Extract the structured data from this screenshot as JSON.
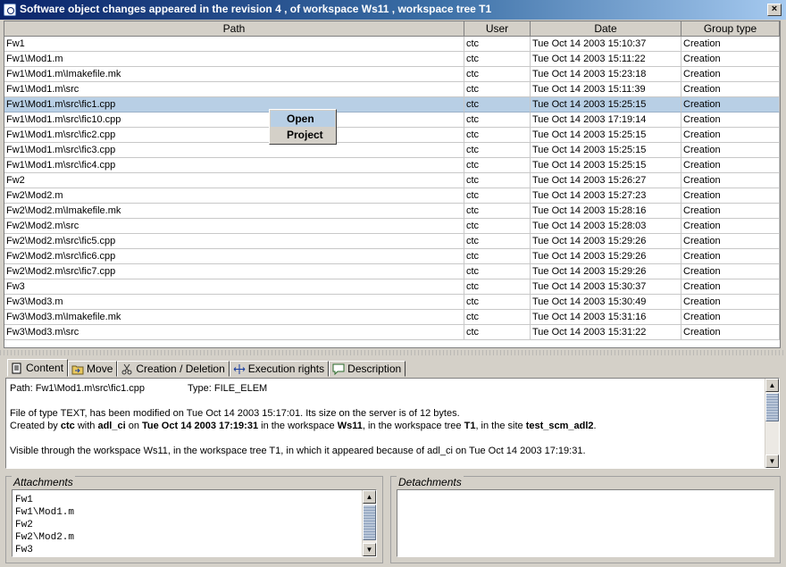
{
  "window": {
    "title": "Software object changes appeared in the revision 4 , of workspace Ws11 , workspace tree T1",
    "close_symbol": "×"
  },
  "table": {
    "columns": [
      "Path",
      "User",
      "Date",
      "Group type"
    ],
    "selected_index": 4,
    "rows": [
      [
        "Fw1",
        "ctc",
        "Tue Oct 14 2003 15:10:37",
        "Creation"
      ],
      [
        "Fw1\\Mod1.m",
        "ctc",
        "Tue Oct 14 2003 15:11:22",
        "Creation"
      ],
      [
        "Fw1\\Mod1.m\\Imakefile.mk",
        "ctc",
        "Tue Oct 14 2003 15:23:18",
        "Creation"
      ],
      [
        "Fw1\\Mod1.m\\src",
        "ctc",
        "Tue Oct 14 2003 15:11:39",
        "Creation"
      ],
      [
        "Fw1\\Mod1.m\\src\\fic1.cpp",
        "ctc",
        "Tue Oct 14 2003 15:25:15",
        "Creation"
      ],
      [
        "Fw1\\Mod1.m\\src\\fic10.cpp",
        "ctc",
        "Tue Oct 14 2003 17:19:14",
        "Creation"
      ],
      [
        "Fw1\\Mod1.m\\src\\fic2.cpp",
        "ctc",
        "Tue Oct 14 2003 15:25:15",
        "Creation"
      ],
      [
        "Fw1\\Mod1.m\\src\\fic3.cpp",
        "ctc",
        "Tue Oct 14 2003 15:25:15",
        "Creation"
      ],
      [
        "Fw1\\Mod1.m\\src\\fic4.cpp",
        "ctc",
        "Tue Oct 14 2003 15:25:15",
        "Creation"
      ],
      [
        "Fw2",
        "ctc",
        "Tue Oct 14 2003 15:26:27",
        "Creation"
      ],
      [
        "Fw2\\Mod2.m",
        "ctc",
        "Tue Oct 14 2003 15:27:23",
        "Creation"
      ],
      [
        "Fw2\\Mod2.m\\Imakefile.mk",
        "ctc",
        "Tue Oct 14 2003 15:28:16",
        "Creation"
      ],
      [
        "Fw2\\Mod2.m\\src",
        "ctc",
        "Tue Oct 14 2003 15:28:03",
        "Creation"
      ],
      [
        "Fw2\\Mod2.m\\src\\fic5.cpp",
        "ctc",
        "Tue Oct 14 2003 15:29:26",
        "Creation"
      ],
      [
        "Fw2\\Mod2.m\\src\\fic6.cpp",
        "ctc",
        "Tue Oct 14 2003 15:29:26",
        "Creation"
      ],
      [
        "Fw2\\Mod2.m\\src\\fic7.cpp",
        "ctc",
        "Tue Oct 14 2003 15:29:26",
        "Creation"
      ],
      [
        "Fw3",
        "ctc",
        "Tue Oct 14 2003 15:30:37",
        "Creation"
      ],
      [
        "Fw3\\Mod3.m",
        "ctc",
        "Tue Oct 14 2003 15:30:49",
        "Creation"
      ],
      [
        "Fw3\\Mod3.m\\Imakefile.mk",
        "ctc",
        "Tue Oct 14 2003 15:31:16",
        "Creation"
      ],
      [
        "Fw3\\Mod3.m\\src",
        "ctc",
        "Tue Oct 14 2003 15:31:22",
        "Creation"
      ]
    ]
  },
  "context_menu": {
    "items": [
      "Open",
      "Project"
    ],
    "highlighted_index": 0
  },
  "tabs": [
    {
      "label": "Content",
      "icon": "document-icon",
      "active": true
    },
    {
      "label": "Move",
      "icon": "folder-move-icon",
      "active": false
    },
    {
      "label": "Creation / Deletion",
      "icon": "scissors-icon",
      "active": false
    },
    {
      "label": "Execution rights",
      "icon": "arrows-icon",
      "active": false
    },
    {
      "label": "Description",
      "icon": "speech-bubble-icon",
      "active": false
    }
  ],
  "details": {
    "path_label": "Path:",
    "path_value": "Fw1\\Mod1.m\\src\\fic1.cpp",
    "type_label": "Type:",
    "type_value": "FILE_ELEM",
    "line1": "File of type TEXT, has been modified on Tue Oct 14 2003 15:17:01. Its size on the server is of 12 bytes.",
    "line2_parts": [
      {
        "text": "Created by ",
        "bold": false
      },
      {
        "text": "ctc",
        "bold": true
      },
      {
        "text": " with ",
        "bold": false
      },
      {
        "text": "adl_ci",
        "bold": true
      },
      {
        "text": " on ",
        "bold": false
      },
      {
        "text": "Tue Oct 14 2003 17:19:31",
        "bold": true
      },
      {
        "text": " in the workspace ",
        "bold": false
      },
      {
        "text": "Ws11",
        "bold": true
      },
      {
        "text": ", in the workspace tree ",
        "bold": false
      },
      {
        "text": "T1",
        "bold": true
      },
      {
        "text": ", in the site ",
        "bold": false
      },
      {
        "text": "test_scm_adl2",
        "bold": true
      },
      {
        "text": ".",
        "bold": false
      }
    ],
    "line3": "Visible through the workspace Ws11, in the workspace tree T1, in which it appeared because of adl_ci on Tue Oct 14 2003 17:19:31."
  },
  "attachments": {
    "title": "Attachments",
    "items": [
      "Fw1",
      "Fw1\\Mod1.m",
      "Fw2",
      "Fw2\\Mod2.m",
      "Fw3"
    ]
  },
  "detachments": {
    "title": "Detachments",
    "items": []
  }
}
